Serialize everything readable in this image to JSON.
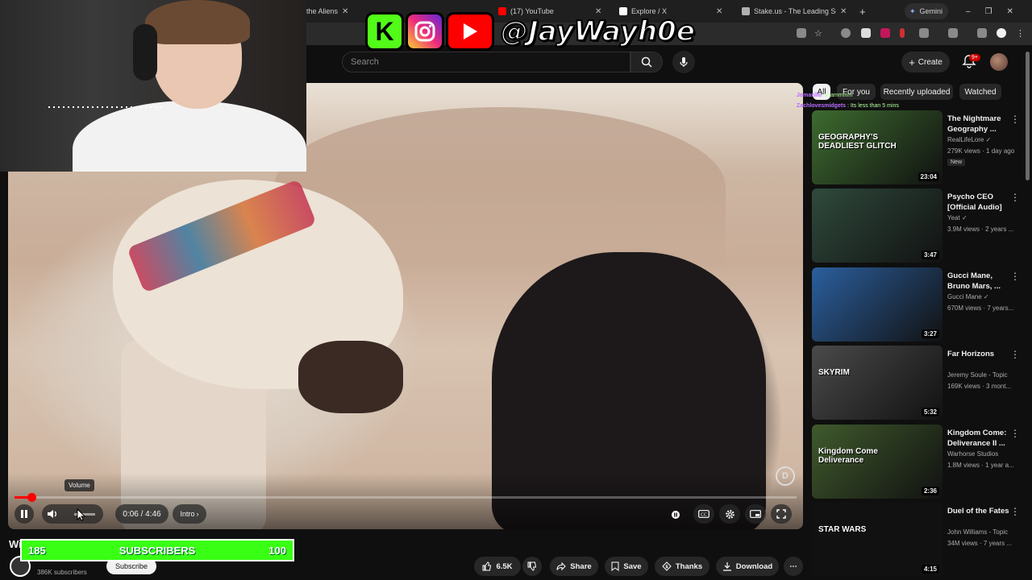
{
  "browser": {
    "tabs": [
      {
        "label": "the Aliens",
        "favicon": "#cc0000"
      },
      {
        "label": "(17) YouTube",
        "favicon": "#ff0000"
      },
      {
        "label": "Explore / X",
        "favicon": "#ffffff"
      },
      {
        "label": "Stake.us - The Leading Social",
        "favicon": "#b0b0b0"
      }
    ],
    "new_tab": "+",
    "gemini": "Gemini",
    "window_controls": [
      "–",
      "❐",
      "✕"
    ]
  },
  "overlay": {
    "kick_letter": "K",
    "handle": "@JayWayh0e"
  },
  "header": {
    "search_placeholder": "Search",
    "create_label": "Create",
    "notification_count": "9+"
  },
  "player": {
    "time": "0:06 / 4:46",
    "chapter": "Intro",
    "volume_tooltip": "Volume",
    "progress_fraction": 0.0217,
    "watermark": "D"
  },
  "chips": [
    "All",
    "For you",
    "Recently uploaded",
    "Watched"
  ],
  "chat": [
    {
      "name": "Jomarillo",
      "text": "hi jammmm"
    },
    {
      "name": "Zachlovesmidgets",
      "text": "Its less than 5 mins"
    }
  ],
  "recommendations": [
    {
      "title": "The Nightmare Geography ...",
      "channel": "RealLifeLore",
      "verified": true,
      "meta": "279K views · 1 day ago",
      "badge": "New",
      "duration": "23:04",
      "thumb_text": "GEOGRAPHY'S DEADLIEST GLITCH",
      "thumb_color": "#3d6b2f"
    },
    {
      "title": "Psycho CEO [Official Audio]",
      "channel": "Yeat",
      "verified": true,
      "meta": "3.9M views · 2 years ...",
      "badge": "",
      "duration": "3:47",
      "thumb_text": "",
      "thumb_color": "#2f4a3c"
    },
    {
      "title": "Gucci Mane, Bruno Mars, ...",
      "channel": "Gucci Mane",
      "verified": true,
      "meta": "670M views · 7 years...",
      "badge": "",
      "duration": "3:27",
      "thumb_text": "",
      "thumb_color": "#2b5f9e"
    },
    {
      "title": "Far Horizons",
      "channel": "Jeremy Soule - Topic",
      "verified": false,
      "meta": "169K views · 3 mont...",
      "badge": "",
      "duration": "5:32",
      "thumb_text": "SKYRIM",
      "thumb_color": "#4a4a4a"
    },
    {
      "title": "Kingdom Come: Deliverance II ...",
      "channel": "Warhorse Studios",
      "verified": false,
      "meta": "1.8M views · 1 year a...",
      "badge": "",
      "duration": "2:36",
      "thumb_text": "Kingdom Come Deliverance",
      "thumb_color": "#3f5a2c"
    },
    {
      "title": "Duel of the Fates",
      "channel": "John Williams - Topic",
      "verified": false,
      "meta": "34M views · 7 years ...",
      "badge": "",
      "duration": "4:15",
      "thumb_text": "STAR WARS",
      "thumb_color": "#111111"
    }
  ],
  "channel": {
    "subs_text": "386K subscribers",
    "subscribe_label": "Subscribe",
    "title_fragment": "Wi"
  },
  "sub_goal": {
    "current": "185",
    "label": "SUBSCRIBERS",
    "goal": "100"
  },
  "actions": {
    "likes": "6.5K",
    "share": "Share",
    "save": "Save",
    "thanks": "Thanks",
    "download": "Download"
  },
  "colors": {
    "accent": "#ff0000",
    "goal_green": "#39ff14",
    "kick_green": "#53fc18"
  }
}
